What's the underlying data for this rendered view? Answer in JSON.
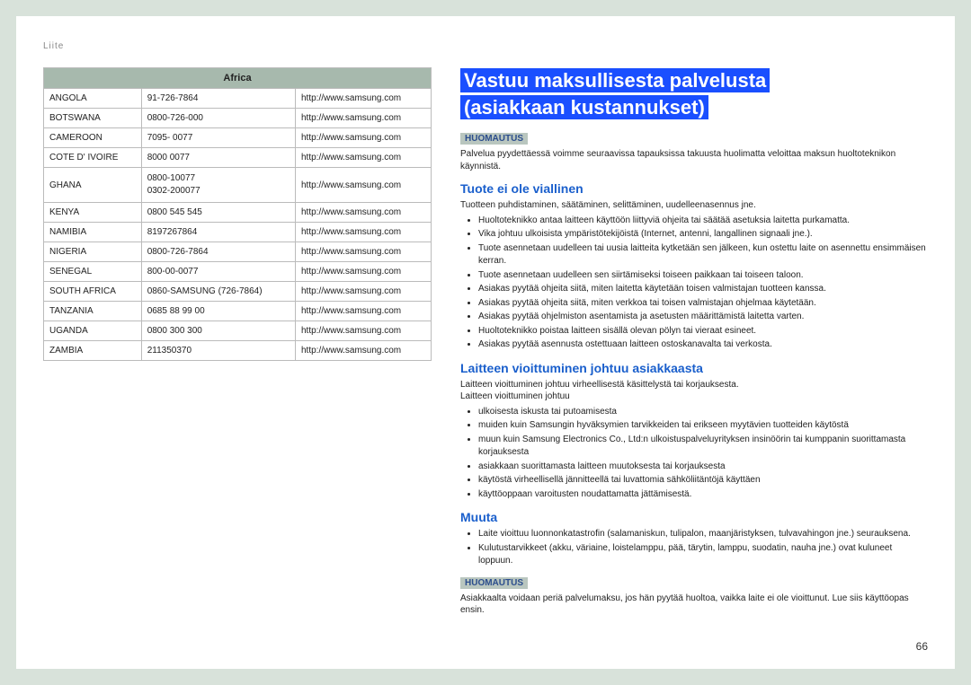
{
  "breadcrumb": "Liite",
  "table": {
    "header": "Africa",
    "rows": [
      {
        "country": "ANGOLA",
        "phone": "91-726-7864",
        "url": "http://www.samsung.com"
      },
      {
        "country": "BOTSWANA",
        "phone": "0800-726-000",
        "url": "http://www.samsung.com"
      },
      {
        "country": "CAMEROON",
        "phone": "7095- 0077",
        "url": "http://www.samsung.com"
      },
      {
        "country": "COTE D' IVOIRE",
        "phone": "8000 0077",
        "url": "http://www.samsung.com"
      },
      {
        "country": "GHANA",
        "phone": "0800-10077\n0302-200077",
        "url": "http://www.samsung.com"
      },
      {
        "country": "KENYA",
        "phone": "0800 545 545",
        "url": "http://www.samsung.com"
      },
      {
        "country": "NAMIBIA",
        "phone": "8197267864",
        "url": "http://www.samsung.com"
      },
      {
        "country": "NIGERIA",
        "phone": "0800-726-7864",
        "url": "http://www.samsung.com"
      },
      {
        "country": "SENEGAL",
        "phone": "800-00-0077",
        "url": "http://www.samsung.com"
      },
      {
        "country": "SOUTH AFRICA",
        "phone": "0860-SAMSUNG (726-7864)",
        "url": "http://www.samsung.com"
      },
      {
        "country": "TANZANIA",
        "phone": "0685 88 99 00",
        "url": "http://www.samsung.com"
      },
      {
        "country": "UGANDA",
        "phone": "0800 300 300",
        "url": "http://www.samsung.com"
      },
      {
        "country": "ZAMBIA",
        "phone": "211350370",
        "url": "http://www.samsung.com"
      }
    ]
  },
  "right": {
    "title_line1": "Vastuu maksullisesta palvelusta",
    "title_line2": "(asiakkaan kustannukset)",
    "notice_label": "HUOMAUTUS",
    "notice1_text": "Palvelua pyydettäessä voimme seuraavissa tapauksissa takuusta huolimatta veloittaa maksun huoltoteknikon käynnistä.",
    "section1": {
      "heading": "Tuote ei ole viallinen",
      "intro": "Tuotteen puhdistaminen, säätäminen, selittäminen, uudelleenasennus jne.",
      "bullets": [
        "Huoltoteknikko antaa laitteen käyttöön liittyviä ohjeita tai säätää asetuksia laitetta purkamatta.",
        "Vika johtuu ulkoisista ympäristötekijöistä (Internet, antenni, langallinen signaali jne.).",
        "Tuote asennetaan uudelleen tai uusia laitteita kytketään sen jälkeen, kun ostettu laite on asennettu ensimmäisen kerran.",
        "Tuote asennetaan uudelleen sen siirtämiseksi toiseen paikkaan tai toiseen taloon.",
        "Asiakas pyytää ohjeita siitä, miten laitetta käytetään toisen valmistajan tuotteen kanssa.",
        "Asiakas pyytää ohjeita siitä, miten verkkoa tai toisen valmistajan ohjelmaa käytetään.",
        "Asiakas pyytää ohjelmiston asentamista ja asetusten määrittämistä laitetta varten.",
        "Huoltoteknikko poistaa laitteen sisällä olevan pölyn tai vieraat esineet.",
        "Asiakas pyytää asennusta ostettuaan laitteen ostoskanavalta tai verkosta."
      ]
    },
    "section2": {
      "heading": "Laitteen vioittuminen johtuu asiakkaasta",
      "intro1": "Laitteen vioittuminen johtuu virheellisestä käsittelystä tai korjauksesta.",
      "intro2": "Laitteen vioittuminen johtuu",
      "bullets": [
        "ulkoisesta iskusta tai putoamisesta",
        "muiden kuin Samsungin hyväksymien tarvikkeiden tai erikseen myytävien tuotteiden käytöstä",
        "muun kuin Samsung Electronics Co., Ltd:n ulkoistuspalveluyrityksen insinöörin tai kumppanin suorittamasta korjauksesta",
        "asiakkaan suorittamasta laitteen muutoksesta tai korjauksesta",
        "käytöstä virheellisellä jännitteellä tai luvattomia sähköliitäntöjä käyttäen",
        "käyttöoppaan varoitusten noudattamatta jättämisestä."
      ]
    },
    "section3": {
      "heading": "Muuta",
      "bullets": [
        "Laite vioittuu luonnonkatastrofin (salamaniskun, tulipalon, maanjäristyksen, tulvavahingon jne.) seurauksena.",
        "Kulutustarvikkeet (akku, väriaine, loistelamppu, pää, tärytin, lamppu, suodatin, nauha jne.) ovat kuluneet loppuun."
      ]
    },
    "notice2_text": "Asiakkaalta voidaan periä palvelumaksu, jos hän pyytää huoltoa, vaikka laite ei ole vioittunut. Lue siis käyttöopas ensin."
  },
  "page_number": "66"
}
